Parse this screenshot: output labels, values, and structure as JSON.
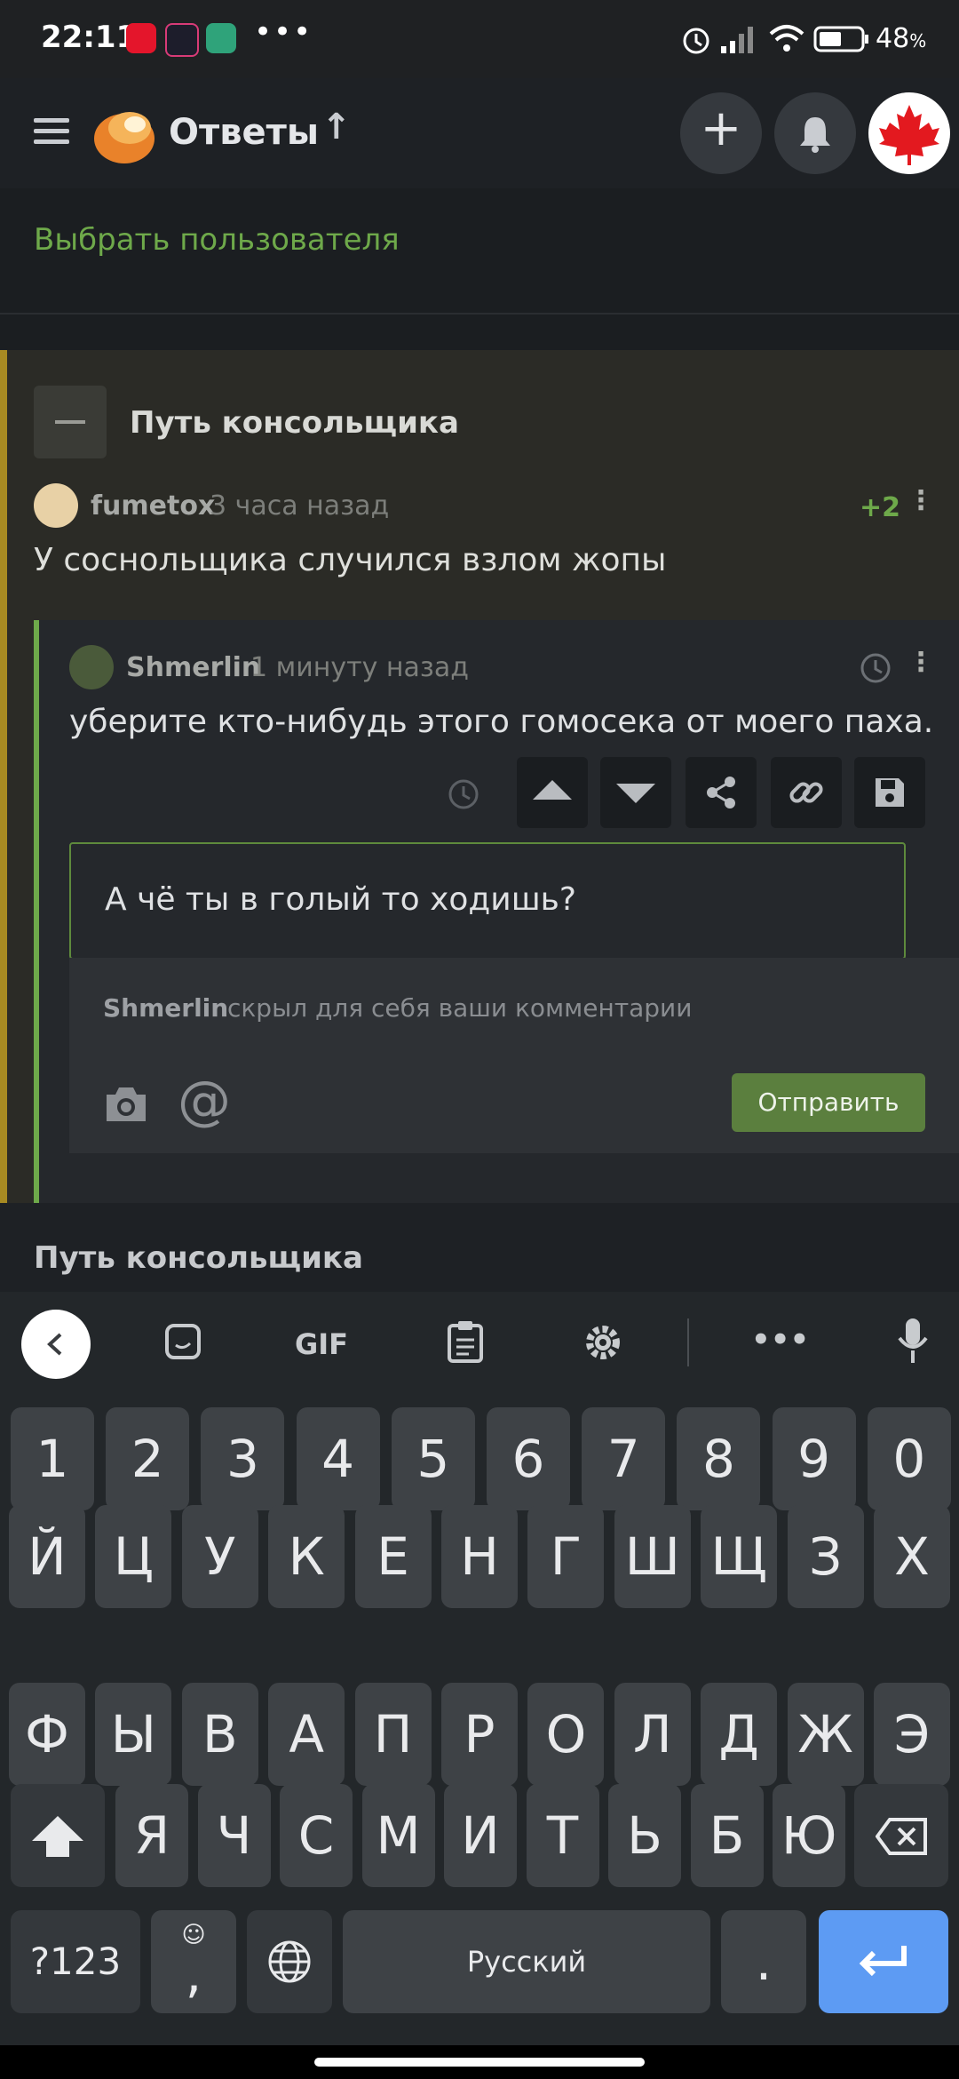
{
  "status_bar": {
    "time": "22:11",
    "dots": "•••",
    "battery": "48",
    "battery_unit": "%"
  },
  "header": {
    "title": "Ответы",
    "arrow": "↑",
    "plus": "+"
  },
  "filter": {
    "select_user": "Выбрать пользователя"
  },
  "post": {
    "title": "Путь консольщика",
    "comment": {
      "user": "fumetox",
      "time": "3 часа назад",
      "score": "+2",
      "text": "У соснольщика случился взлом жопы"
    },
    "reply": {
      "user": "Shmerlin",
      "time": "1 минуту назад",
      "text": "уберите кто-нибудь этого гомосека от моего паха."
    },
    "input_value": "А чё ты в голый то ходишь?",
    "hidden_user": "Shmerlin",
    "hidden_text": "скрыл для себя ваши комментарии",
    "send_label": "Отправить"
  },
  "below_title": "Путь консольщика",
  "keyboard": {
    "toolbar": {
      "gif": "GIF",
      "more": "•••"
    },
    "rows": [
      [
        "1",
        "2",
        "3",
        "4",
        "5",
        "6",
        "7",
        "8",
        "9",
        "0"
      ],
      [
        "Й",
        "Ц",
        "У",
        "К",
        "Е",
        "Н",
        "Г",
        "Ш",
        "Щ",
        "З",
        "Х"
      ],
      [
        "Ф",
        "Ы",
        "В",
        "А",
        "П",
        "Р",
        "О",
        "Л",
        "Д",
        "Ж",
        "Э"
      ],
      [
        "Я",
        "Ч",
        "С",
        "М",
        "И",
        "Т",
        "Ь",
        "Б",
        "Ю"
      ]
    ],
    "symbols_label": "?123",
    "comma": ",",
    "space_label": "Русский",
    "period": "."
  }
}
